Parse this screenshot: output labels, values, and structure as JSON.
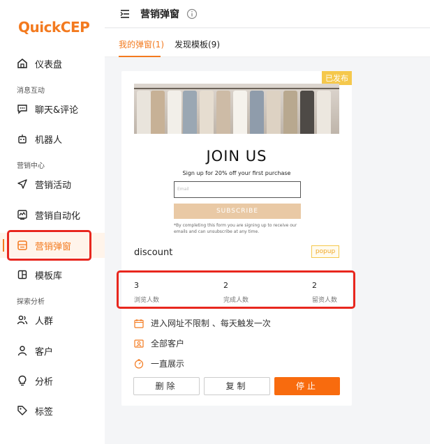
{
  "app": {
    "logo_q": "Q",
    "logo_rest": "uickCEP"
  },
  "sidebar": {
    "items": [
      {
        "label": "仪表盘",
        "icon": "home-icon"
      },
      {
        "label": "聊天&评论",
        "icon": "chat-icon"
      },
      {
        "label": "机器人",
        "icon": "robot-icon"
      },
      {
        "label": "营销活动",
        "icon": "send-icon"
      },
      {
        "label": "营销自动化",
        "icon": "automation-icon"
      },
      {
        "label": "营销弹窗",
        "icon": "popup-icon",
        "active": true
      },
      {
        "label": "模板库",
        "icon": "template-icon"
      },
      {
        "label": "人群",
        "icon": "people-icon"
      },
      {
        "label": "客户",
        "icon": "user-icon"
      },
      {
        "label": "分析",
        "icon": "bulb-icon"
      },
      {
        "label": "标签",
        "icon": "tag-icon"
      }
    ],
    "groups": [
      "消息互动",
      "营销中心",
      "探索分析"
    ]
  },
  "header": {
    "title": "营销弹窗"
  },
  "tabs": [
    {
      "label": "我的弹窗(1)",
      "active": true
    },
    {
      "label": "发现模板(9)"
    }
  ],
  "card": {
    "status": "已发布",
    "preview": {
      "headline": "JOIN US",
      "subtitle": "Sign up for 20% off your first purchase",
      "email_placeholder": "Email",
      "button": "SUBSCRIBE",
      "terms": "*By completing this form you are signing up to receive our emails and can unsubscribe at any time."
    },
    "name": "discount",
    "type": "popup",
    "stats": [
      {
        "value": "3",
        "label": "浏览人数"
      },
      {
        "value": "2",
        "label": "完成人数"
      },
      {
        "value": "2",
        "label": "留资人数"
      }
    ],
    "meta": [
      {
        "text": "进入网址不限制 、每天触发一次",
        "icon": "calendar-icon"
      },
      {
        "text": "全部客户",
        "icon": "audience-icon"
      },
      {
        "text": "一直展示",
        "icon": "timer-icon"
      }
    ],
    "buttons": {
      "delete": "删除",
      "copy": "复制",
      "stop": "停止"
    }
  },
  "colors": {
    "accent": "#f37a1f",
    "highlight": "#e8271e",
    "badge": "#f5c84c",
    "stop": "#f86b0e"
  }
}
